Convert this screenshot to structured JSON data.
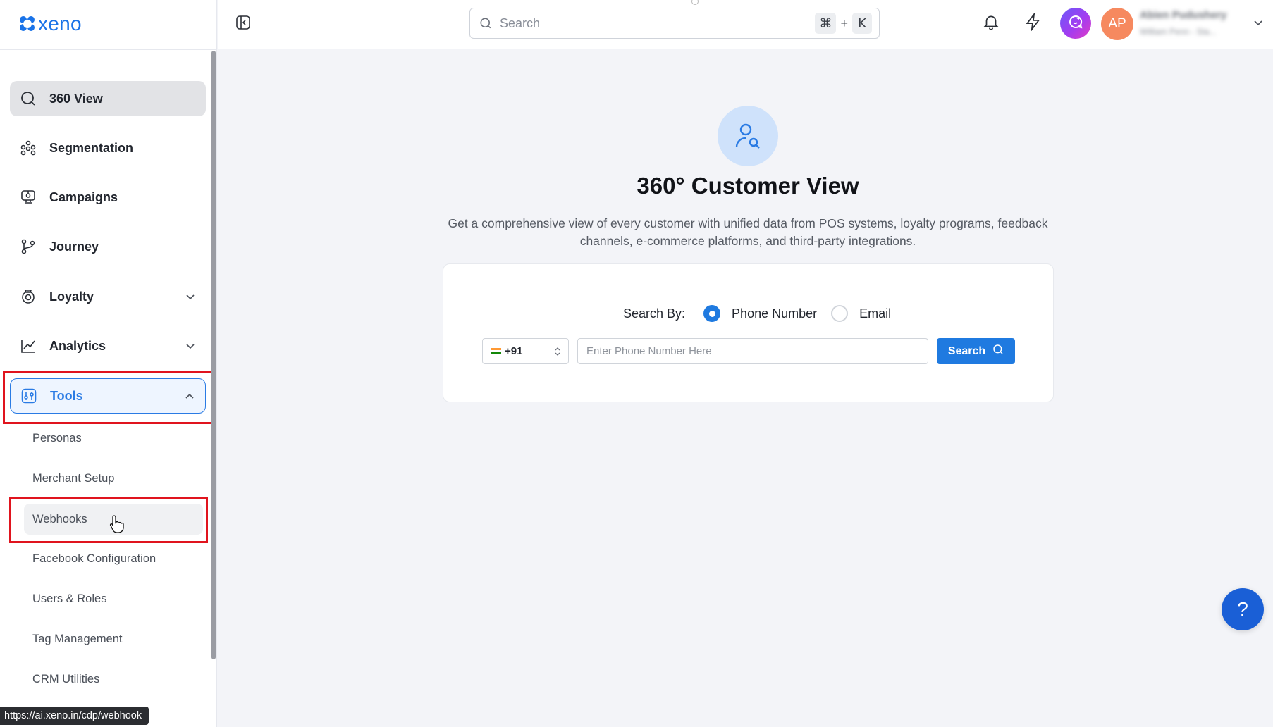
{
  "brand": {
    "logo_text": "xeno",
    "accent": "#1a73e8"
  },
  "header": {
    "search_placeholder": "Search",
    "shortcut_key1": "⌘",
    "shortcut_plus": "+",
    "shortcut_key2": "K",
    "icons": [
      "sidebar-collapse-icon",
      "bell-icon",
      "lightning-icon",
      "ai-assistant-icon"
    ],
    "avatar_initials": "AP",
    "user_name": "Abien Pudushery",
    "user_subtitle": "William Penn - Sta..."
  },
  "sidebar": {
    "items": [
      {
        "label": "360 View",
        "icon": "search-icon",
        "active": true
      },
      {
        "label": "Segmentation",
        "icon": "segmentation-icon"
      },
      {
        "label": "Campaigns",
        "icon": "campaigns-icon"
      },
      {
        "label": "Journey",
        "icon": "journey-icon"
      },
      {
        "label": "Loyalty",
        "icon": "loyalty-icon",
        "expandable": true
      },
      {
        "label": "Analytics",
        "icon": "analytics-icon",
        "expandable": true
      },
      {
        "label": "Tools",
        "icon": "tools-icon",
        "expanded": true
      }
    ],
    "tools_submenu": [
      "Personas",
      "Merchant Setup",
      "Webhooks",
      "Facebook Configuration",
      "Users & Roles",
      "Tag Management",
      "CRM Utilities"
    ],
    "hovered_item": "Webhooks"
  },
  "status_url": "https://ai.xeno.in/cdp/webhook",
  "main": {
    "title": "360° Customer View",
    "description": "Get a comprehensive view of every customer with unified data from POS systems, loyalty programs, feedback channels, e-commerce platforms, and third-party integrations.",
    "search_by_label": "Search By:",
    "options": [
      {
        "label": "Phone Number",
        "selected": true
      },
      {
        "label": "Email",
        "selected": false
      }
    ],
    "country_code": "+91",
    "phone_placeholder": "Enter Phone Number Here",
    "search_button": "Search",
    "primary_color": "#1f7ae0"
  },
  "help_button": "?"
}
